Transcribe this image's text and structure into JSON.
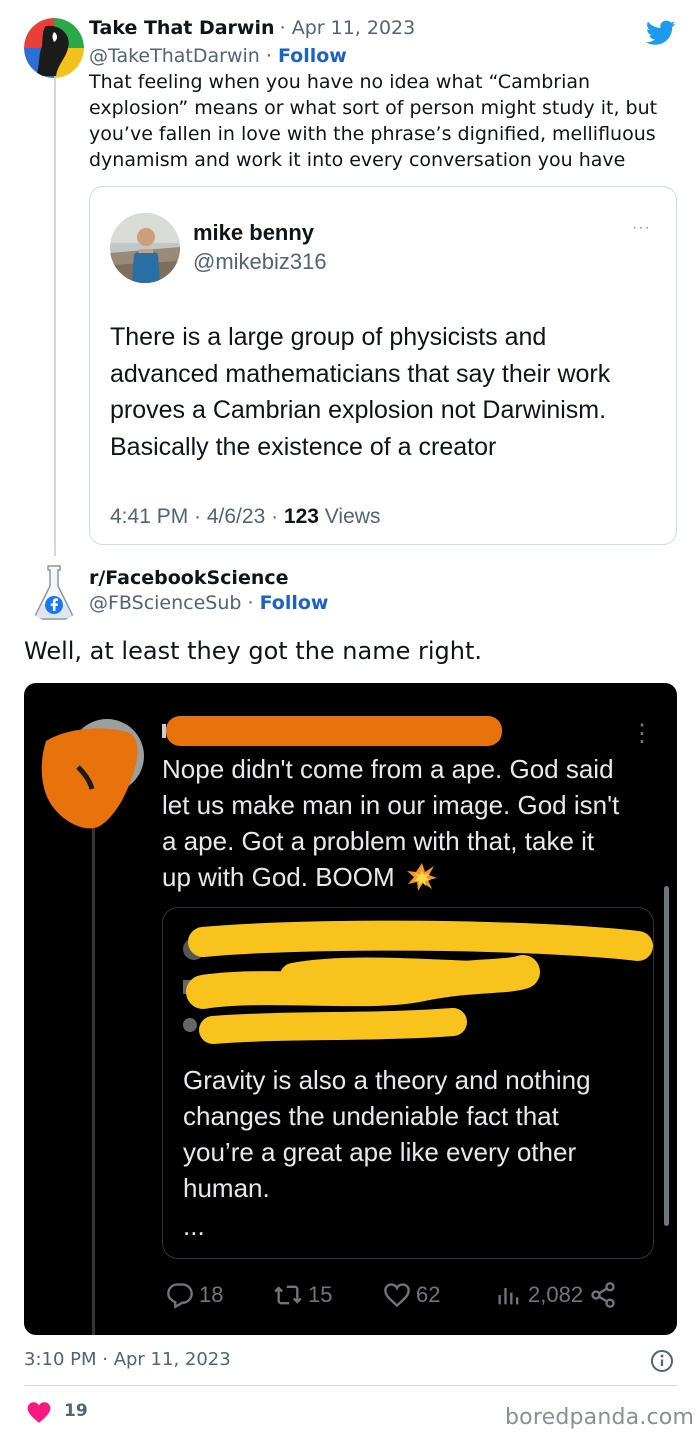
{
  "tweet1": {
    "author_name": "Take That Darwin",
    "date": "· Apr 11, 2023",
    "handle": "@TakeThatDarwin",
    "sep": " · ",
    "follow": "Follow",
    "text_lines": [
      "That feeling when you have no idea what “Cambrian",
      "explosion” means or what sort of person might study it, but",
      "you’ve fallen in love with the phrase’s  dignified, mellifluous",
      "dynamism and work it into every conversation you have"
    ],
    "quoted": {
      "name": "mike benny",
      "handle": "@mikebiz316",
      "more": "···",
      "body_lines": [
        "There is a large group of physicists and",
        "advanced mathematicians that say their work",
        "proves a Cambrian explosion not Darwinism.",
        "Basically the existence of a creator"
      ],
      "meta_time": "4:41 PM · 4/6/23 · ",
      "views_count": "123",
      "views_label": " Views"
    }
  },
  "tweet2": {
    "author_name": "r/FacebookScience",
    "handle": "@FBScienceSub",
    "sep": " · ",
    "follow": "Follow",
    "text": "Well, at least they got the name right.",
    "dark": {
      "more": "⋮",
      "reply_lines": [
        "Nope didn't come from a ape. God said",
        "let us make man in our image.  God isn't",
        "a ape. Got a problem with that, take it",
        "up with God.  BOOM"
      ],
      "boom_icon": "💥",
      "quoted_lines": [
        "Gravity is also a theory and nothing",
        "changes the undeniable fact that",
        "you’re a great ape like every other",
        "human."
      ],
      "ellipsis": "...",
      "metrics": {
        "replies": "18",
        "retweets": "15",
        "likes": "62",
        "views": "2,082"
      }
    },
    "timestamp": "3:10 PM · Apr 11, 2023",
    "like_count": "19"
  },
  "watermark": "boredpanda.com",
  "colors": {
    "twitter_blue": "#1d9bf0",
    "follow_blue": "#1d63c7",
    "heart": "#f91880",
    "redact_orange": "#e8720c",
    "redact_yellow": "#f7c31c"
  }
}
